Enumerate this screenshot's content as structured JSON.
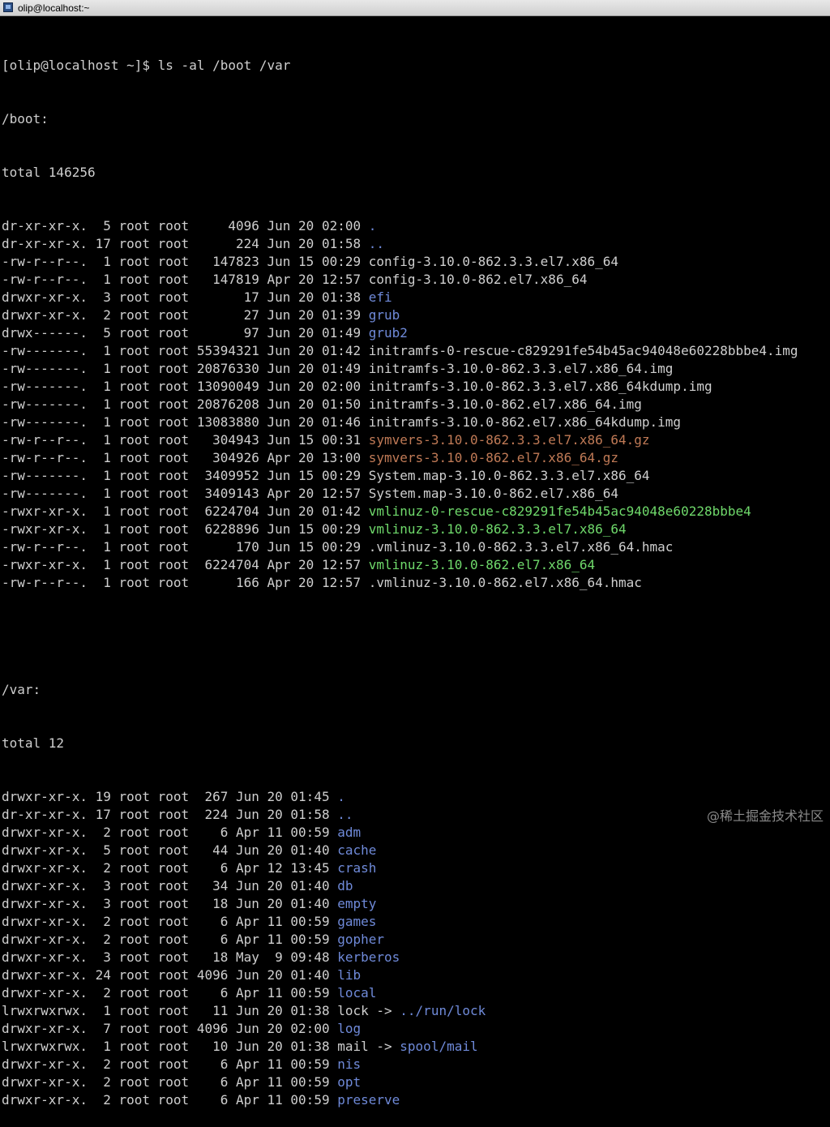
{
  "window": {
    "title": "olip@localhost:~"
  },
  "terminal": {
    "prompt": "[olip@localhost ~]$ ",
    "command": "ls -al /boot /var",
    "boot": {
      "header": "/boot:",
      "total": "total 146256",
      "rows": [
        {
          "meta": "dr-xr-xr-x.  5 root root     4096 Jun 20 02:00 ",
          "name": ".",
          "type": "dir"
        },
        {
          "meta": "dr-xr-xr-x. 17 root root      224 Jun 20 01:58 ",
          "name": "..",
          "type": "dir"
        },
        {
          "meta": "-rw-r--r--.  1 root root   147823 Jun 15 00:29 ",
          "name": "config-3.10.0-862.3.3.el7.x86_64",
          "type": "file"
        },
        {
          "meta": "-rw-r--r--.  1 root root   147819 Apr 20 12:57 ",
          "name": "config-3.10.0-862.el7.x86_64",
          "type": "file"
        },
        {
          "meta": "drwxr-xr-x.  3 root root       17 Jun 20 01:38 ",
          "name": "efi",
          "type": "dir"
        },
        {
          "meta": "drwxr-xr-x.  2 root root       27 Jun 20 01:39 ",
          "name": "grub",
          "type": "dir"
        },
        {
          "meta": "drwx------.  5 root root       97 Jun 20 01:49 ",
          "name": "grub2",
          "type": "dir"
        },
        {
          "meta": "-rw-------.  1 root root 55394321 Jun 20 01:42 ",
          "name": "initramfs-0-rescue-c829291fe54b45ac94048e60228bbbe4.img",
          "type": "file"
        },
        {
          "meta": "-rw-------.  1 root root 20876330 Jun 20 01:49 ",
          "name": "initramfs-3.10.0-862.3.3.el7.x86_64.img",
          "type": "file"
        },
        {
          "meta": "-rw-------.  1 root root 13090049 Jun 20 02:00 ",
          "name": "initramfs-3.10.0-862.3.3.el7.x86_64kdump.img",
          "type": "file"
        },
        {
          "meta": "-rw-------.  1 root root 20876208 Jun 20 01:50 ",
          "name": "initramfs-3.10.0-862.el7.x86_64.img",
          "type": "file"
        },
        {
          "meta": "-rw-------.  1 root root 13083880 Jun 20 01:46 ",
          "name": "initramfs-3.10.0-862.el7.x86_64kdump.img",
          "type": "file"
        },
        {
          "meta": "-rw-r--r--.  1 root root   304943 Jun 15 00:31 ",
          "name": "symvers-3.10.0-862.3.3.el7.x86_64.gz",
          "type": "arc"
        },
        {
          "meta": "-rw-r--r--.  1 root root   304926 Apr 20 13:00 ",
          "name": "symvers-3.10.0-862.el7.x86_64.gz",
          "type": "arc"
        },
        {
          "meta": "-rw-------.  1 root root  3409952 Jun 15 00:29 ",
          "name": "System.map-3.10.0-862.3.3.el7.x86_64",
          "type": "file"
        },
        {
          "meta": "-rw-------.  1 root root  3409143 Apr 20 12:57 ",
          "name": "System.map-3.10.0-862.el7.x86_64",
          "type": "file"
        },
        {
          "meta": "-rwxr-xr-x.  1 root root  6224704 Jun 20 01:42 ",
          "name": "vmlinuz-0-rescue-c829291fe54b45ac94048e60228bbbe4",
          "type": "exe"
        },
        {
          "meta": "-rwxr-xr-x.  1 root root  6228896 Jun 15 00:29 ",
          "name": "vmlinuz-3.10.0-862.3.3.el7.x86_64",
          "type": "exe"
        },
        {
          "meta": "-rw-r--r--.  1 root root      170 Jun 15 00:29 ",
          "name": ".vmlinuz-3.10.0-862.3.3.el7.x86_64.hmac",
          "type": "file"
        },
        {
          "meta": "-rwxr-xr-x.  1 root root  6224704 Apr 20 12:57 ",
          "name": "vmlinuz-3.10.0-862.el7.x86_64",
          "type": "exe"
        },
        {
          "meta": "-rw-r--r--.  1 root root      166 Apr 20 12:57 ",
          "name": ".vmlinuz-3.10.0-862.el7.x86_64.hmac",
          "type": "file"
        }
      ]
    },
    "var": {
      "header": "/var:",
      "total": "total 12",
      "rows": [
        {
          "meta": "drwxr-xr-x. 19 root root  267 Jun 20 01:45 ",
          "name": ".",
          "type": "dir"
        },
        {
          "meta": "dr-xr-xr-x. 17 root root  224 Jun 20 01:58 ",
          "name": "..",
          "type": "dir"
        },
        {
          "meta": "drwxr-xr-x.  2 root root    6 Apr 11 00:59 ",
          "name": "adm",
          "type": "dir"
        },
        {
          "meta": "drwxr-xr-x.  5 root root   44 Jun 20 01:40 ",
          "name": "cache",
          "type": "dir"
        },
        {
          "meta": "drwxr-xr-x.  2 root root    6 Apr 12 13:45 ",
          "name": "crash",
          "type": "dir"
        },
        {
          "meta": "drwxr-xr-x.  3 root root   34 Jun 20 01:40 ",
          "name": "db",
          "type": "dir"
        },
        {
          "meta": "drwxr-xr-x.  3 root root   18 Jun 20 01:40 ",
          "name": "empty",
          "type": "dir"
        },
        {
          "meta": "drwxr-xr-x.  2 root root    6 Apr 11 00:59 ",
          "name": "games",
          "type": "dir"
        },
        {
          "meta": "drwxr-xr-x.  2 root root    6 Apr 11 00:59 ",
          "name": "gopher",
          "type": "dir"
        },
        {
          "meta": "drwxr-xr-x.  3 root root   18 May  9 09:48 ",
          "name": "kerberos",
          "type": "dir"
        },
        {
          "meta": "drwxr-xr-x. 24 root root 4096 Jun 20 01:40 ",
          "name": "lib",
          "type": "dir"
        },
        {
          "meta": "drwxr-xr-x.  2 root root    6 Apr 11 00:59 ",
          "name": "local",
          "type": "dir"
        },
        {
          "meta": "lrwxrwxrwx.  1 root root   11 Jun 20 01:38 ",
          "name": "lock",
          "arrow": " -> ",
          "target": "../run/lock",
          "type": "link"
        },
        {
          "meta": "drwxr-xr-x.  7 root root 4096 Jun 20 02:00 ",
          "name": "log",
          "type": "dir"
        },
        {
          "meta": "lrwxrwxrwx.  1 root root   10 Jun 20 01:38 ",
          "name": "mail",
          "arrow": " -> ",
          "target": "spool/mail",
          "type": "link"
        },
        {
          "meta": "drwxr-xr-x.  2 root root    6 Apr 11 00:59 ",
          "name": "nis",
          "type": "dir"
        },
        {
          "meta": "drwxr-xr-x.  2 root root    6 Apr 11 00:59 ",
          "name": "opt",
          "type": "dir"
        },
        {
          "meta": "drwxr-xr-x.  2 root root    6 Apr 11 00:59 ",
          "name": "preserve",
          "type": "dir"
        }
      ]
    }
  },
  "watermark": "@稀土掘金技术社区"
}
